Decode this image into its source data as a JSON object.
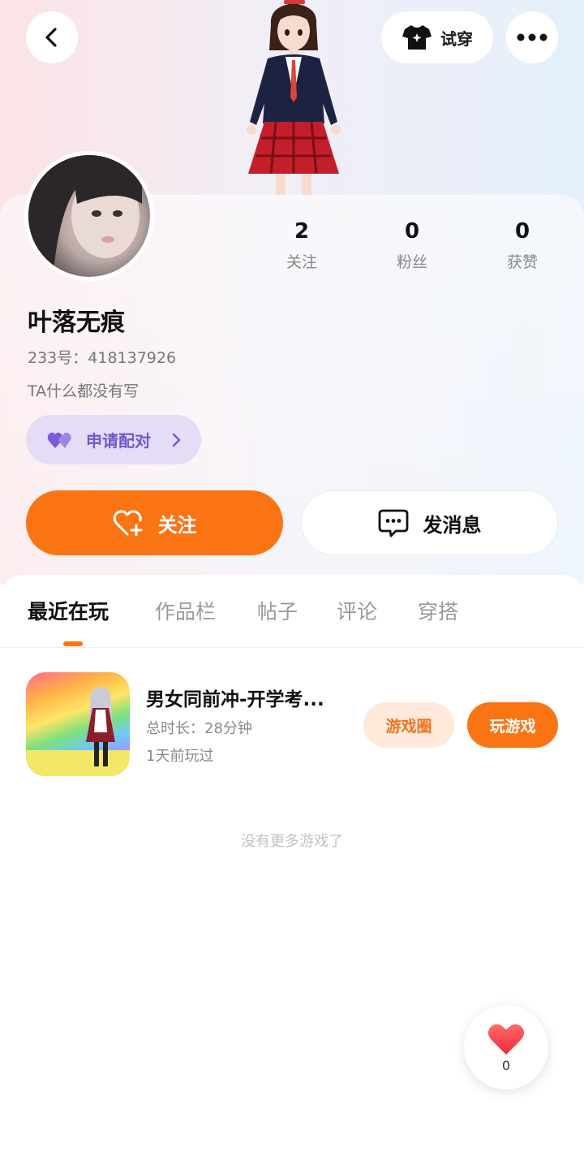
{
  "header": {
    "try_on_label": "试穿"
  },
  "profile": {
    "username": "叶落无痕",
    "uid": "233号：418137926",
    "bio": "TA什么都没有写",
    "stats": [
      {
        "value": "2",
        "label": "关注"
      },
      {
        "value": "0",
        "label": "粉丝"
      },
      {
        "value": "0",
        "label": "获赞"
      }
    ],
    "pair_label": "申请配对"
  },
  "actions": {
    "follow_label": "关注",
    "message_label": "发消息"
  },
  "tabs": [
    {
      "label": "最近在玩",
      "active": true
    },
    {
      "label": "作品栏",
      "active": false
    },
    {
      "label": "帖子",
      "active": false
    },
    {
      "label": "评论",
      "active": false
    },
    {
      "label": "穿搭",
      "active": false
    }
  ],
  "recent_games": [
    {
      "title": "男女同前冲-开学考...",
      "duration": "总时长：28分钟",
      "last_played": "1天前玩过",
      "circle_label": "游戏圈",
      "play_label": "玩游戏"
    }
  ],
  "no_more_text": "没有更多游戏了",
  "like": {
    "count": "0"
  },
  "colors": {
    "accent": "#fb7414",
    "pair_bg": "#e6dcf6",
    "pair_text": "#6f5ad0",
    "circle_pill_bg": "#ffeadb"
  }
}
